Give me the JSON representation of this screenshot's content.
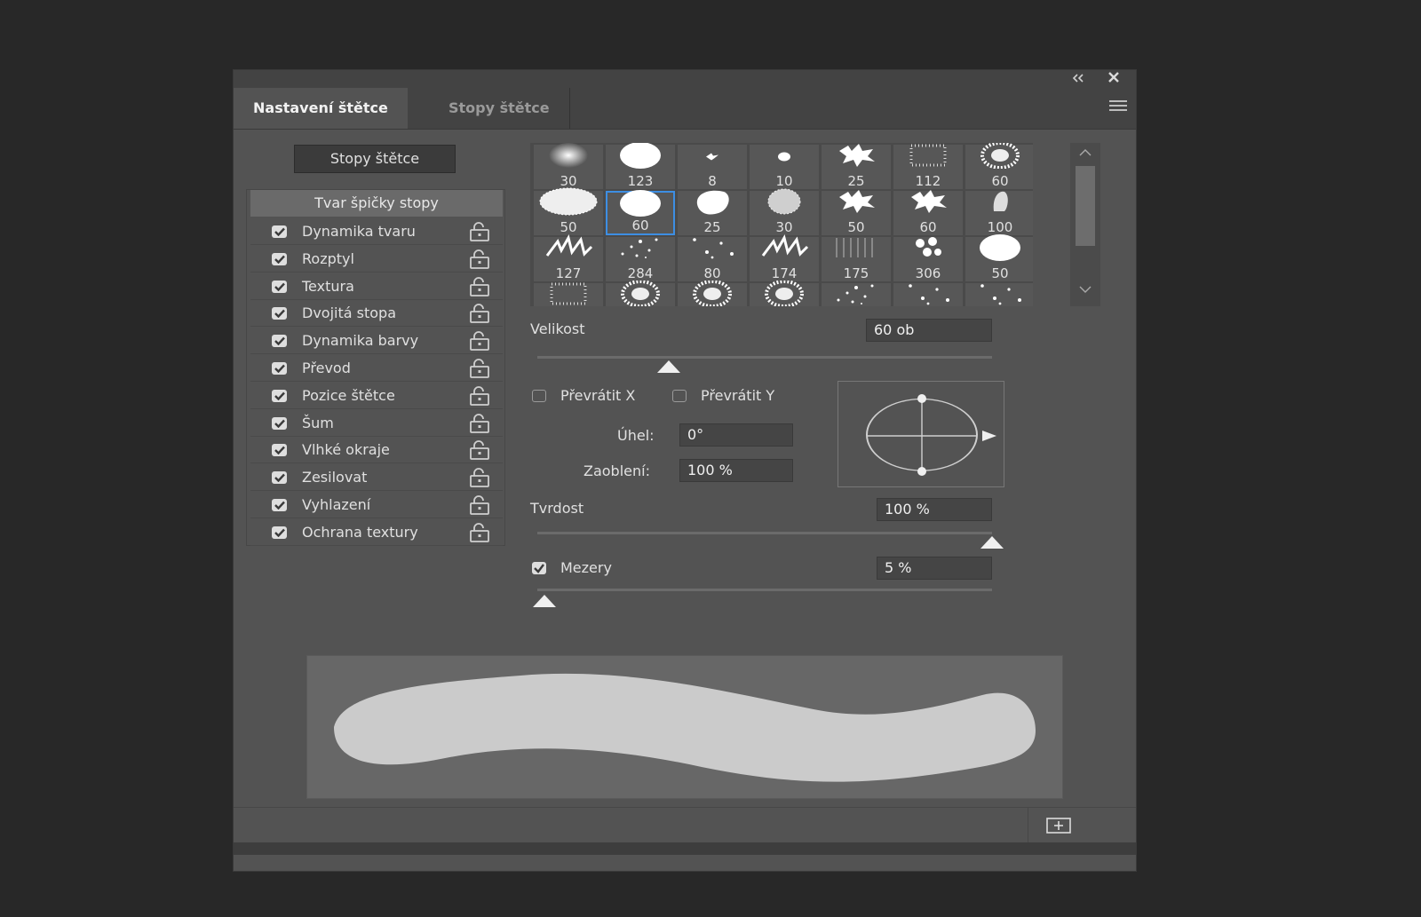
{
  "window": {
    "collapse_icon": "double-chevron-left-icon",
    "close_icon": "close-icon"
  },
  "tabs": [
    {
      "label": "Nastavení štětce",
      "active": true
    },
    {
      "label": "Stopy štětce",
      "active": false
    }
  ],
  "left": {
    "brushes_button": "Stopy štětce",
    "section_header": "Tvar špičky stopy",
    "options": [
      {
        "label": "Dynamika tvaru",
        "checked": true
      },
      {
        "label": "Rozptyl",
        "checked": true
      },
      {
        "label": "Textura",
        "checked": true
      },
      {
        "label": "Dvojitá stopa",
        "checked": true
      },
      {
        "label": "Dynamika barvy",
        "checked": true
      },
      {
        "label": "Převod",
        "checked": true
      },
      {
        "label": "Pozice štětce",
        "checked": true
      },
      {
        "label": "Šum",
        "checked": true
      },
      {
        "label": "Vlhké okraje",
        "checked": true
      },
      {
        "label": "Zesilovat",
        "checked": true
      },
      {
        "label": "Vyhlazení",
        "checked": true
      },
      {
        "label": "Ochrana textury",
        "checked": true
      }
    ]
  },
  "brush_presets": [
    {
      "size": "30",
      "kind": "soft"
    },
    {
      "size": "123",
      "kind": "hard"
    },
    {
      "size": "8",
      "kind": "splat"
    },
    {
      "size": "10",
      "kind": "hard-small"
    },
    {
      "size": "25",
      "kind": "leaf"
    },
    {
      "size": "112",
      "kind": "texture"
    },
    {
      "size": "60",
      "kind": "sponge"
    },
    {
      "size": "50",
      "kind": "spray"
    },
    {
      "size": "60",
      "kind": "hard",
      "selected": true
    },
    {
      "size": "25",
      "kind": "blob"
    },
    {
      "size": "30",
      "kind": "fuzzy"
    },
    {
      "size": "50",
      "kind": "leaf"
    },
    {
      "size": "60",
      "kind": "leaf"
    },
    {
      "size": "100",
      "kind": "bristle"
    },
    {
      "size": "127",
      "kind": "grass"
    },
    {
      "size": "284",
      "kind": "scatter"
    },
    {
      "size": "80",
      "kind": "dots"
    },
    {
      "size": "174",
      "kind": "grass"
    },
    {
      "size": "175",
      "kind": "hatch"
    },
    {
      "size": "306",
      "kind": "flower"
    },
    {
      "size": "50",
      "kind": "hard"
    },
    {
      "size": "",
      "kind": "texture"
    },
    {
      "size": "",
      "kind": "sponge"
    },
    {
      "size": "",
      "kind": "sponge"
    },
    {
      "size": "",
      "kind": "sponge"
    },
    {
      "size": "",
      "kind": "scatter"
    },
    {
      "size": "",
      "kind": "dots"
    },
    {
      "size": "",
      "kind": "dots"
    }
  ],
  "size": {
    "label": "Velikost",
    "value": "60 ob",
    "level": 0.29
  },
  "flip": {
    "x_label": "Převrátit X",
    "y_label": "Převrátit Y",
    "x_checked": false,
    "y_checked": false
  },
  "angle": {
    "label": "Úhel:",
    "value": "0°"
  },
  "roundness": {
    "label": "Zaoblení:",
    "value": "100 %"
  },
  "hardness": {
    "label": "Tvrdost",
    "value": "100 %",
    "level": 1.0
  },
  "spacing": {
    "label": "Mezery",
    "value": "5 %",
    "checked": true,
    "level": 0.0
  },
  "footer": {
    "new_brush_icon": "new-brush-icon"
  },
  "colors": {
    "accent": "#3d8ee3",
    "panel": "#535353",
    "background": "#282828"
  }
}
